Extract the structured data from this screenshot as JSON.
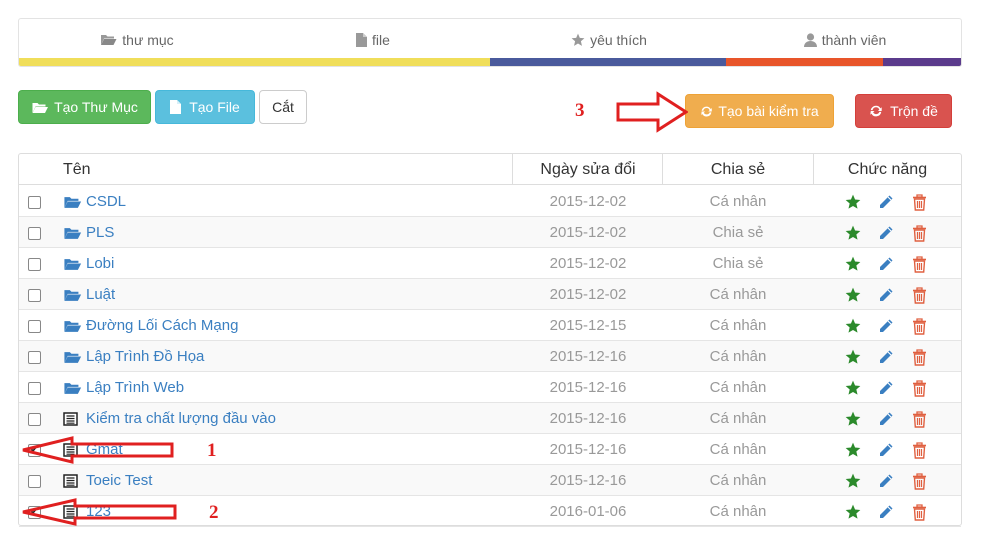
{
  "tabs": [
    {
      "label": "thư mục",
      "icon": "folder-open-icon",
      "color": "#f0de5a"
    },
    {
      "label": "file",
      "icon": "file-icon",
      "color": "#f0de5a"
    },
    {
      "label": "yêu thích",
      "icon": "star-icon",
      "color": "#4a5a9c"
    },
    {
      "label": "thành viên",
      "icon": "user-icon",
      "color": "#e8552a"
    }
  ],
  "tab_bar_colors": [
    "#f0de5a",
    "#4a5a9c",
    "#e8552a",
    "#5b3b8c"
  ],
  "toolbar": {
    "create_folder": "Tạo Thư Mục",
    "create_file": "Tạo File",
    "cut": "Cắt",
    "create_test": "Tạo bài kiểm tra",
    "shuffle": "Trộn đề"
  },
  "colors": {
    "success": "#5cb85c",
    "info": "#5bc0de",
    "warning": "#f0ad4e",
    "danger": "#d9534f",
    "link": "#3a7fc1"
  },
  "table": {
    "headers": {
      "name": "Tên",
      "modified": "Ngày sửa đổi",
      "share": "Chia sẻ",
      "actions": "Chức năng"
    },
    "rows": [
      {
        "type": "folder",
        "name": "CSDL",
        "date": "2015-12-02",
        "share": "Cá nhân",
        "checked": false
      },
      {
        "type": "folder",
        "name": "PLS",
        "date": "2015-12-02",
        "share": "Chia sẻ",
        "checked": false
      },
      {
        "type": "folder",
        "name": "Lobi",
        "date": "2015-12-02",
        "share": "Chia sẻ",
        "checked": false
      },
      {
        "type": "folder",
        "name": "Luật",
        "date": "2015-12-02",
        "share": "Cá nhân",
        "checked": false
      },
      {
        "type": "folder",
        "name": "Đường Lối Cách Mạng",
        "date": "2015-12-15",
        "share": "Cá nhân",
        "checked": false
      },
      {
        "type": "folder",
        "name": "Lập Trình Đồ Họa",
        "date": "2015-12-16",
        "share": "Cá nhân",
        "checked": false
      },
      {
        "type": "folder",
        "name": "Lập Trình Web",
        "date": "2015-12-16",
        "share": "Cá nhân",
        "checked": false
      },
      {
        "type": "file",
        "name": "Kiểm tra chất lượng đầu vào",
        "date": "2015-12-16",
        "share": "Cá nhân",
        "checked": false
      },
      {
        "type": "file",
        "name": "Gmat",
        "date": "2015-12-16",
        "share": "Cá nhân",
        "checked": true
      },
      {
        "type": "file",
        "name": "Toeic Test",
        "date": "2015-12-16",
        "share": "Cá nhân",
        "checked": false
      },
      {
        "type": "file",
        "name": "123",
        "date": "2016-01-06",
        "share": "Cá nhân",
        "checked": true
      }
    ]
  },
  "annotations": {
    "one": "1",
    "two": "2",
    "three": "3"
  }
}
